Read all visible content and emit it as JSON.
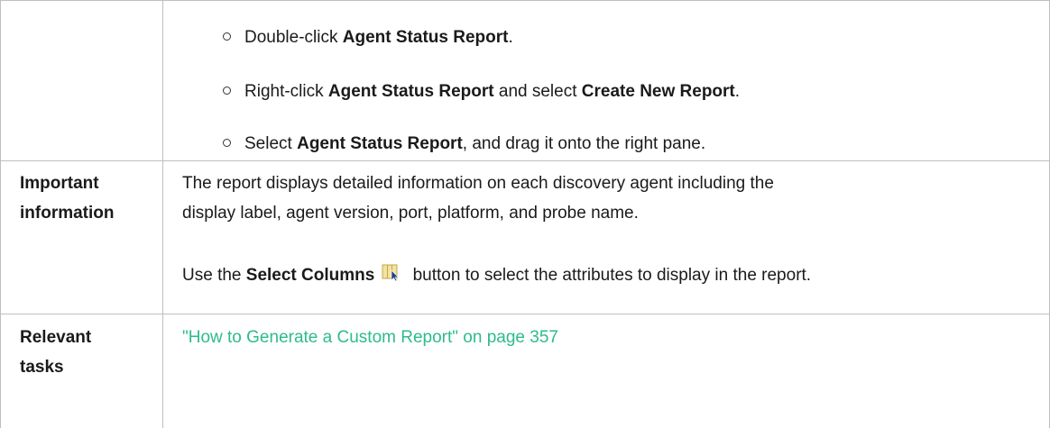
{
  "bullets": [
    {
      "pre": "Double-click ",
      "b1": "Agent Status Report",
      "mid": ".",
      "b2": "",
      "post": ""
    },
    {
      "pre": "Right-click ",
      "b1": "Agent Status Report",
      "mid": " and select ",
      "b2": "Create New Report",
      "post": "."
    },
    {
      "pre": "Select ",
      "b1": "Agent Status Report",
      "mid": ", and drag it onto the right pane.",
      "b2": "",
      "post": ""
    }
  ],
  "important": {
    "label_line1": "Important",
    "label_line2": "information",
    "para1_line1": "The report displays detailed information on each discovery agent including the",
    "para1_line2": "display label, agent version, port, platform, and probe name.",
    "para2_pre": "Use the ",
    "para2_bold": "Select Columns",
    "para2_post": " button to select the attributes to display in the report.",
    "icon": "select-columns-icon"
  },
  "relevant": {
    "label_line1": "Relevant",
    "label_line2": "tasks",
    "link_text": "\"How to Generate a Custom Report\" on page 357"
  },
  "colors": {
    "link": "#2dbb8d",
    "border": "#bfbfbf"
  }
}
